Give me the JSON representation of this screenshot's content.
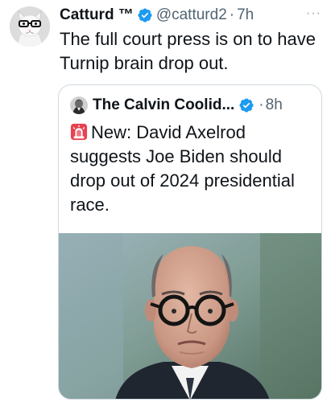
{
  "tweet": {
    "display_name": "Catturd ™",
    "handle": "@catturd2",
    "separator": "·",
    "time": "7h",
    "more": "···",
    "text": "The full court press is on to have Turnip brain drop out.",
    "avatar_icon": "cat-with-glasses-avatar",
    "verified_color": "#1d9bf0"
  },
  "quote": {
    "display_name": "The Calvin Coolid...",
    "separator": "·",
    "time": "8h",
    "emoji_icon": "police-siren-icon",
    "text": "New: David Axelrod suggests Joe Biden should drop out of 2024 presidential race.",
    "photo": "photo-of-man-with-round-glasses"
  },
  "colors": {
    "text": "#0f1419",
    "muted": "#536471",
    "border": "#cfd9de",
    "accent": "#1d9bf0"
  }
}
